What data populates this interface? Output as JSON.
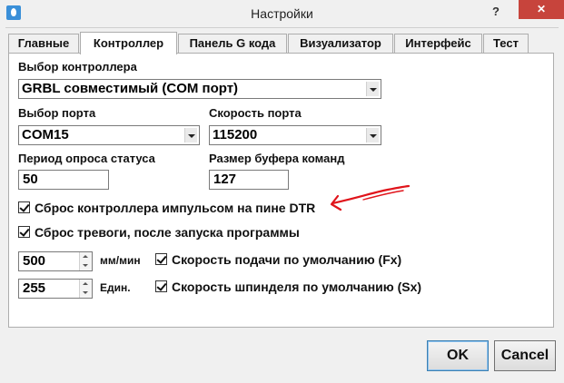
{
  "window": {
    "title": "Настройки",
    "help_label": "?",
    "close_label": "✕"
  },
  "tabs": [
    {
      "label": "Главные"
    },
    {
      "label": "Контроллер"
    },
    {
      "label": "Панель G кода"
    },
    {
      "label": "Визуализатор"
    },
    {
      "label": "Интерфейс"
    },
    {
      "label": "Тест"
    }
  ],
  "active_tab": "Контроллер",
  "controller": {
    "select_label": "Выбор контроллера",
    "select_value": "GRBL совместимый (COM порт)"
  },
  "port": {
    "label": "Выбор порта",
    "value": "COM15"
  },
  "speed": {
    "label": "Скорость порта",
    "value": "115200"
  },
  "poll": {
    "label": "Период опроса статуса",
    "value": "50"
  },
  "buffer": {
    "label": "Размер буфера команд",
    "value": "127"
  },
  "checks": {
    "dtr_reset": {
      "label": "Сброс контроллера импульсом на пине DTR",
      "checked": true
    },
    "alarm_reset": {
      "label": "Сброс тревоги, после запуска программы",
      "checked": true
    },
    "default_feed": {
      "label": "Скорость подачи по умолчанию (Fx)",
      "checked": true
    },
    "default_spindle": {
      "label": "Скорость шпинделя по умолчанию (Sx)",
      "checked": true
    }
  },
  "feed": {
    "value": "500",
    "unit": "мм/мин"
  },
  "spindle": {
    "value": "255",
    "unit": "Един."
  },
  "annotation": {
    "color": "#e0141b"
  },
  "buttons": {
    "ok": "OK",
    "cancel": "Cancel"
  }
}
